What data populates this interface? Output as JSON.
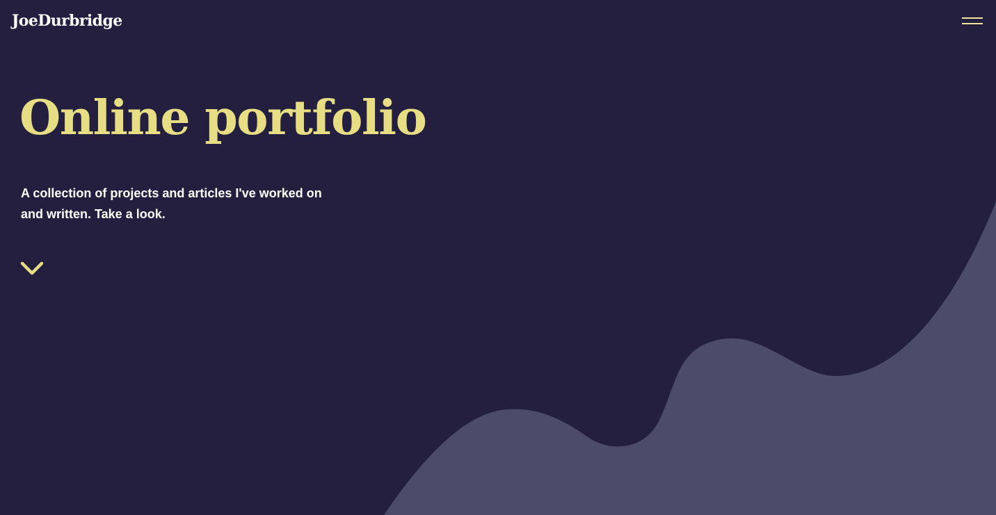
{
  "header": {
    "logo_text": "JoeDurbridge",
    "menu_icon": "hamburger-menu-icon"
  },
  "hero": {
    "title": "Online portfolio",
    "subtitle": "A collection of projects and articles I've worked on and written. Take a look.",
    "scroll_icon": "chevron-down-icon"
  },
  "colors": {
    "background": "#241f3e",
    "wave": "#4c4b69",
    "accent": "#e6dd84",
    "text": "#ffffff"
  }
}
